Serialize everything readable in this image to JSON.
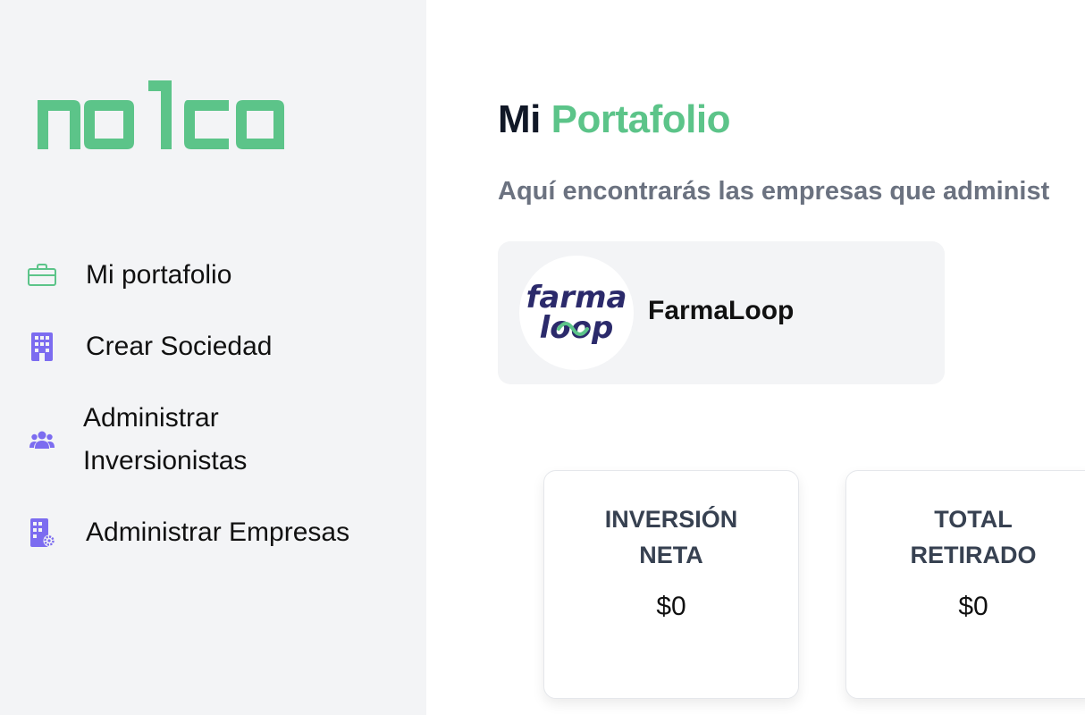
{
  "brand": {
    "name": "nolco",
    "color": "#5cc489"
  },
  "sidebar": {
    "items": [
      {
        "label": "Mi portafolio",
        "icon": "briefcase-icon",
        "icon_color": "#5cc489"
      },
      {
        "label": "Crear Sociedad",
        "icon": "building-icon",
        "icon_color": "#7c6cf0"
      },
      {
        "label": "Administrar Inversionistas",
        "icon": "users-icon",
        "icon_color": "#7c6cf0"
      },
      {
        "label": "Administrar Empresas",
        "icon": "building-gear-icon",
        "icon_color": "#7c6cf0"
      }
    ]
  },
  "main": {
    "title_part1": "Mi",
    "title_part2": "Portafolio",
    "subtitle": "Aquí encontrarás las empresas que administ",
    "company": {
      "name": "FarmaLoop",
      "logo_text_top": "farma",
      "logo_text_bottom": "loop"
    },
    "stats": [
      {
        "label": "INVERSIÓN NETA",
        "value": "$0"
      },
      {
        "label": "TOTAL RETIRADO",
        "value": "$0"
      }
    ]
  },
  "colors": {
    "accent": "#5cc489",
    "sidebar_bg": "#f3f4f6",
    "icon_purple": "#7c6cf0",
    "farmaloop_navy": "#2b2a6b"
  }
}
